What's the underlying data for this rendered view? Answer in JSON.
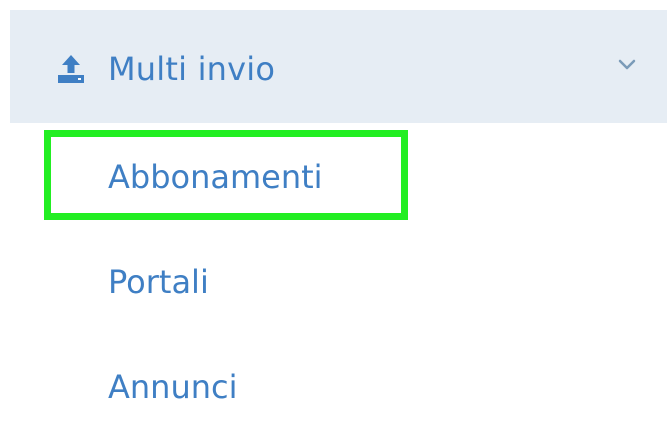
{
  "menu": {
    "header": {
      "label": "Multi invio",
      "icon": "upload-icon",
      "toggle_icon": "chevron-down-icon"
    },
    "items": [
      {
        "label": "Abbonamenti",
        "highlighted": true
      },
      {
        "label": "Portali"
      },
      {
        "label": "Annunci"
      }
    ]
  },
  "colors": {
    "header_background": "#e6edf4",
    "text": "#3f7fc4",
    "icon": "#3f7fc4",
    "chevron": "#7a9bb8",
    "highlight": "#22ee22"
  }
}
